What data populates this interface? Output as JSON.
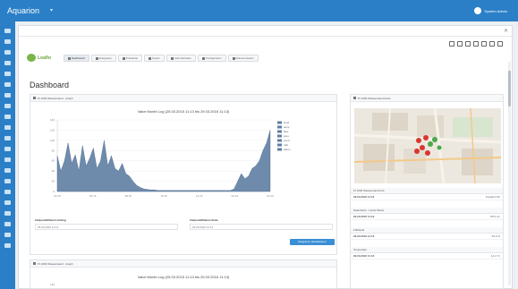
{
  "topbar": {
    "brand": "Aquarion",
    "user": "System Admin"
  },
  "tabs": [
    {
      "label": "Dashboard",
      "active": true
    },
    {
      "label": "Ereignisse",
      "active": false
    },
    {
      "label": "Protokolle",
      "active": false
    },
    {
      "label": "Karten",
      "active": false
    },
    {
      "label": "Administration",
      "active": false
    },
    {
      "label": "Konfiguration",
      "active": false
    },
    {
      "label": "Dokumentation",
      "active": false
    }
  ],
  "page": {
    "title": "Dashboard",
    "logo": "Loaflo"
  },
  "chart_panel": {
    "header": "Pt 1000 Wasserstand - Graph",
    "title": "Valve Month Log (25.03.2015 11:13 bis 29.03.2016 11:13)",
    "from_label": "Zeitpunkt/Datum Anfang",
    "from_value": "25.03.2015 11:13",
    "to_label": "Zeitpunkt/Datum Ende",
    "to_value": "29.03.2016 11:13",
    "button": "Diagramm aktualisieren"
  },
  "chart_data": {
    "type": "area",
    "x_tick_labels": [
      "04.15",
      "06.15",
      "08.15",
      "10.15",
      "12.15",
      "02.16",
      "04.16"
    ],
    "y_tick_labels": [
      "140",
      "120",
      "100",
      "80",
      "60",
      "40",
      "20",
      "0"
    ],
    "ylim": [
      0,
      140
    ],
    "legend": [
      "level",
      "temp",
      "flow",
      "pres",
      "cond",
      "turb",
      "alarm"
    ],
    "series": [
      {
        "values": [
          70,
          40,
          60,
          95,
          55,
          72,
          40,
          90,
          50,
          65,
          85,
          45,
          60,
          100,
          50,
          70,
          45,
          40,
          55,
          35,
          30,
          20,
          12,
          8,
          5,
          4,
          3,
          3,
          2,
          2,
          2,
          2,
          2,
          2,
          2,
          2,
          2,
          2,
          2,
          2,
          2,
          2,
          2,
          2,
          2,
          2,
          2,
          2,
          2,
          5,
          20,
          35,
          25,
          30,
          45,
          50,
          60,
          80,
          95,
          120
        ]
      }
    ]
  },
  "second_panel": {
    "header": "Pt 1000 Wasserstand - Graph",
    "title": "Valve Month Log (25.03.2015 11:13 bis 29.03.2016 11:13)",
    "ytick": "140"
  },
  "sidebar": {
    "map_header": "Pt 1000 Wasserstand Karte",
    "sections": [
      {
        "head": "Pt 1000 Wasserstand Info",
        "rows": [
          {
            "k": "29.03.2016 11:13",
            "v": "Zustand OK"
          }
        ]
      },
      {
        "head": "Datenbank - Letzte Werte",
        "rows": [
          {
            "k": "29.03.2016 11:13",
            "v": "83.0 cm"
          }
        ]
      },
      {
        "head": "Füllstand",
        "rows": [
          {
            "k": "29.03.2016 11:13",
            "v": "53.0 %"
          }
        ]
      },
      {
        "head": "Temperatur",
        "rows": [
          {
            "k": "29.03.2016 11:13",
            "v": "12.4 °C"
          }
        ]
      }
    ]
  }
}
